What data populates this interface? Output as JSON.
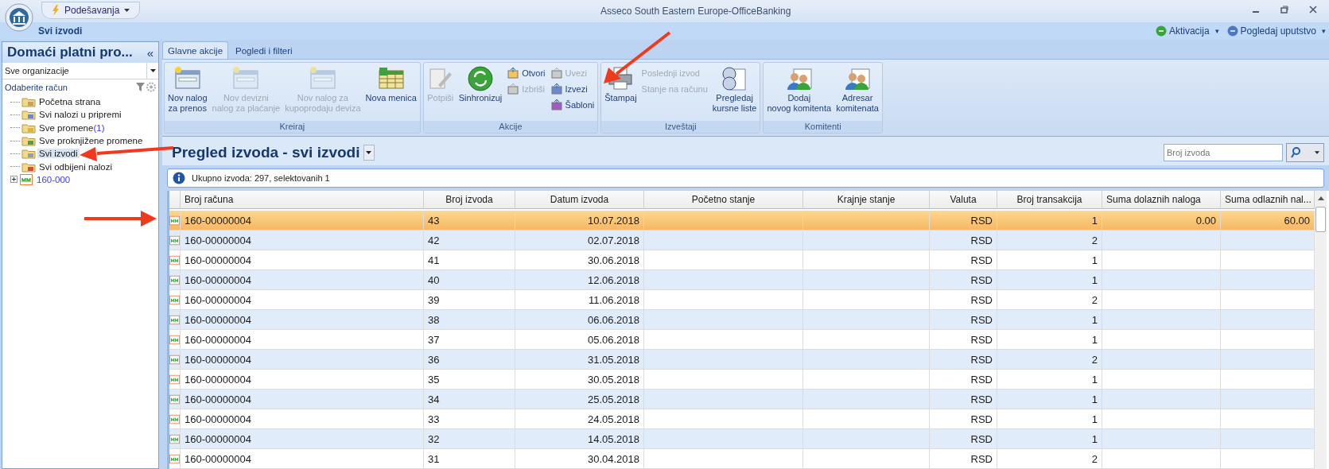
{
  "window": {
    "title": "Asseco South Eastern Europe-OfficeBanking",
    "quick_access": "Podešavanja",
    "breadcrumb": "Svi izvodi",
    "help_links": [
      {
        "label": "Aktivacija",
        "caret": "▾"
      },
      {
        "label": "Pogledaj uputstvo",
        "caret": "▾"
      }
    ]
  },
  "sidebar": {
    "title": "Domaći platni pro...",
    "collapse": "«",
    "organization": "Sve organizacije",
    "account_label": "Odaberite račun",
    "items": [
      {
        "label": "Početna strana",
        "selected": false
      },
      {
        "label": "Svi nalozi u pripremi",
        "selected": false
      },
      {
        "label": "Sve promene",
        "count": "(1)",
        "selected": false
      },
      {
        "label": "Sve proknjižene promene",
        "selected": false
      },
      {
        "label": "Svi izvodi",
        "selected": true
      },
      {
        "label": "Svi odbijeni nalozi",
        "selected": false
      },
      {
        "label": "160-000",
        "selected": false,
        "expanded": false,
        "kind": "account"
      }
    ]
  },
  "ribbon": {
    "tabs": [
      {
        "label": "Glavne akcije",
        "selected": true
      },
      {
        "label": "Pogledi i filteri",
        "selected": false
      }
    ],
    "groups": [
      {
        "title": "Kreiraj",
        "items": [
          {
            "kind": "large",
            "lines": [
              "Nov nalog",
              "za prenos"
            ],
            "disabled": false
          },
          {
            "kind": "large",
            "lines": [
              "Nov devizni",
              "nalog za plaćanje"
            ],
            "disabled": true
          },
          {
            "kind": "large",
            "lines": [
              "Nov nalog za",
              "kupoprodaju deviza"
            ],
            "disabled": true
          },
          {
            "kind": "large",
            "lines": [
              "Nova menica"
            ],
            "disabled": false
          }
        ]
      },
      {
        "title": "Akcije",
        "items": [
          {
            "kind": "large",
            "lines": [
              "Potpiši"
            ],
            "disabled": true
          },
          {
            "kind": "large",
            "lines": [
              "Sinhronizuj"
            ],
            "disabled": false
          },
          {
            "kind": "stack",
            "items": [
              {
                "label": "Otvori",
                "disabled": false
              },
              {
                "label": "Izbriši",
                "disabled": true
              }
            ]
          },
          {
            "kind": "stack",
            "items": [
              {
                "label": "Uvezi",
                "disabled": true
              },
              {
                "label": "Izvezi",
                "disabled": false
              },
              {
                "label": "Šabloni",
                "disabled": false
              }
            ]
          }
        ]
      },
      {
        "title": "Izveštaji",
        "items": [
          {
            "kind": "large",
            "lines": [
              "Štampaj"
            ],
            "disabled": false
          },
          {
            "kind": "stack",
            "items": [
              {
                "label": "Poslednji izvod",
                "disabled": true
              },
              {
                "label": "Stanje na računu",
                "disabled": true
              }
            ]
          },
          {
            "kind": "large",
            "lines": [
              "Pregledaj",
              "kursne liste"
            ],
            "disabled": false
          }
        ]
      },
      {
        "title": "Komitenti",
        "items": [
          {
            "kind": "large",
            "lines": [
              "Dodaj",
              "novog komitenta"
            ],
            "disabled": false
          },
          {
            "kind": "large",
            "lines": [
              "Adresar",
              "komitenata"
            ],
            "disabled": false
          }
        ]
      }
    ]
  },
  "view": {
    "title": "Pregled izvoda - svi izvodi",
    "search": {
      "placeholder": "Broj izvoda"
    },
    "info": "Ukupno izvoda: 297, selektovanih 1"
  },
  "table": {
    "columns": [
      "Broj računa",
      "Broj izvoda",
      "Datum izvoda",
      "Početno stanje",
      "Krajnje stanje",
      "Valuta",
      "Broj transakcija",
      "Suma dolaznih naloga",
      "Suma odlaznih nal..."
    ],
    "rows": [
      {
        "account": "160-00000004",
        "number": "43",
        "date": "10.07.2018",
        "currency": "RSD",
        "transactions": "1",
        "incoming": "0.00",
        "outgoing": "60.00",
        "selected": true
      },
      {
        "account": "160-00000004",
        "number": "42",
        "date": "02.07.2018",
        "currency": "RSD",
        "transactions": "2",
        "selected": false
      },
      {
        "account": "160-00000004",
        "number": "41",
        "date": "30.06.2018",
        "currency": "RSD",
        "transactions": "1",
        "selected": false
      },
      {
        "account": "160-00000004",
        "number": "40",
        "date": "12.06.2018",
        "currency": "RSD",
        "transactions": "1",
        "selected": false
      },
      {
        "account": "160-00000004",
        "number": "39",
        "date": "11.06.2018",
        "currency": "RSD",
        "transactions": "2",
        "selected": false
      },
      {
        "account": "160-00000004",
        "number": "38",
        "date": "06.06.2018",
        "currency": "RSD",
        "transactions": "1",
        "selected": false
      },
      {
        "account": "160-00000004",
        "number": "37",
        "date": "05.06.2018",
        "currency": "RSD",
        "transactions": "1",
        "selected": false
      },
      {
        "account": "160-00000004",
        "number": "36",
        "date": "31.05.2018",
        "currency": "RSD",
        "transactions": "2",
        "selected": false
      },
      {
        "account": "160-00000004",
        "number": "35",
        "date": "30.05.2018",
        "currency": "RSD",
        "transactions": "1",
        "selected": false
      },
      {
        "account": "160-00000004",
        "number": "34",
        "date": "25.05.2018",
        "currency": "RSD",
        "transactions": "1",
        "selected": false
      },
      {
        "account": "160-00000004",
        "number": "33",
        "date": "24.05.2018",
        "currency": "RSD",
        "transactions": "1",
        "selected": false
      },
      {
        "account": "160-00000004",
        "number": "32",
        "date": "14.05.2018",
        "currency": "RSD",
        "transactions": "1",
        "selected": false
      },
      {
        "account": "160-00000004",
        "number": "31",
        "date": "30.04.2018",
        "currency": "RSD",
        "transactions": "2",
        "selected": false
      }
    ]
  }
}
